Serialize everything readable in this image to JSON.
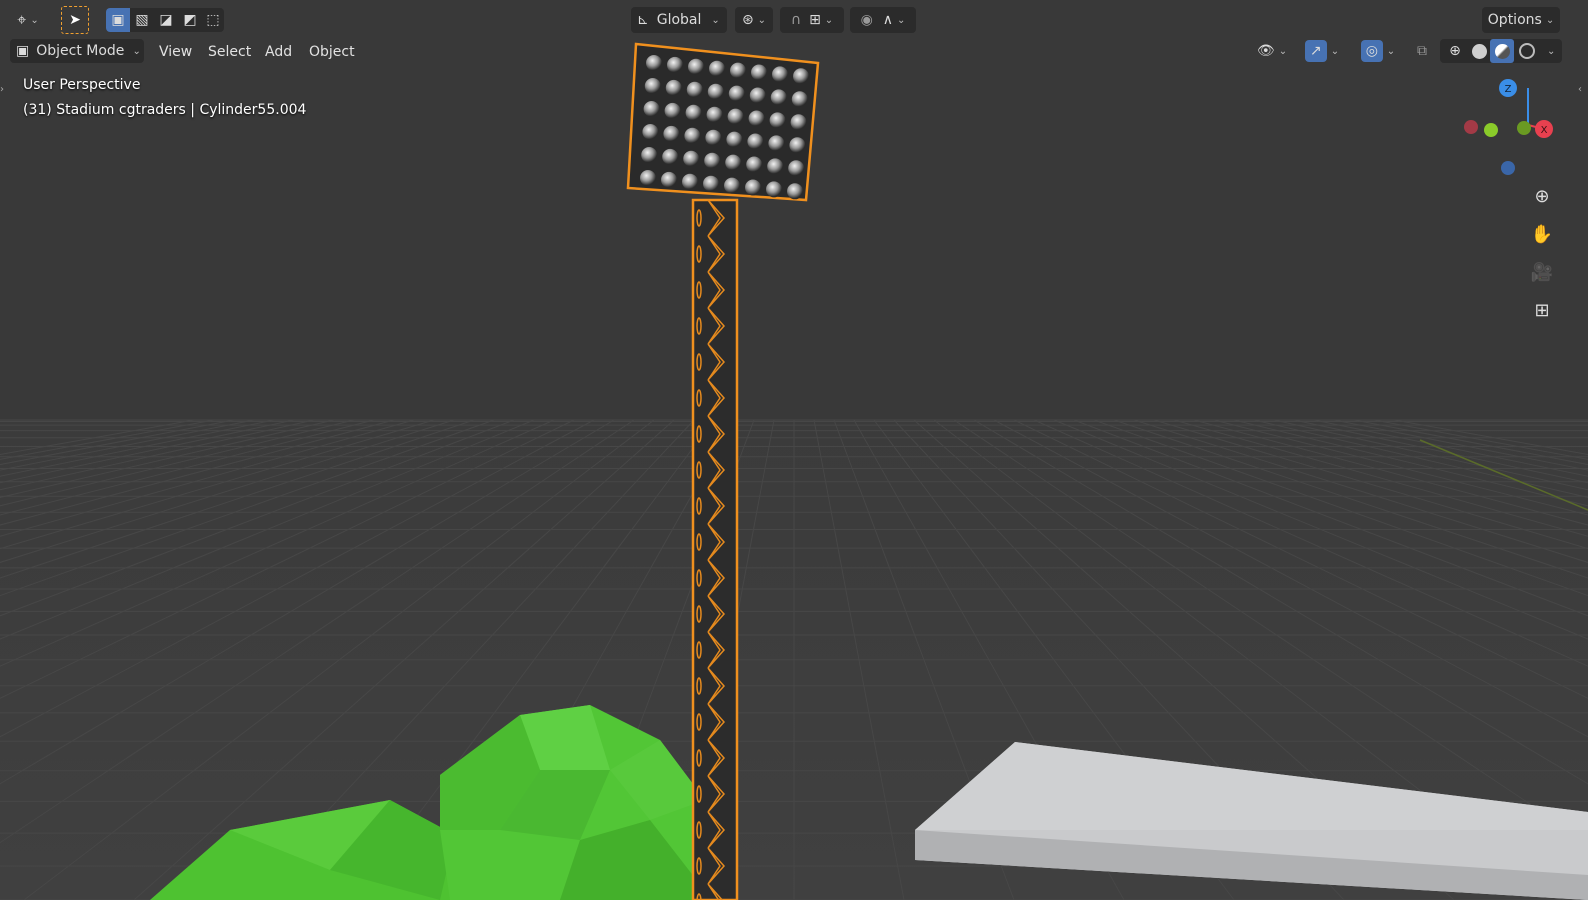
{
  "topbar": {
    "transform_orientation": "Global",
    "options_label": "Options"
  },
  "menubar": {
    "mode_label": "Object Mode",
    "menus": [
      "View",
      "Select",
      "Add",
      "Object"
    ]
  },
  "viewport": {
    "perspective_label": "User Perspective",
    "object_info": "(31) Stadium cgtraders | Cylinder55.004"
  },
  "gizmo": {
    "axis_z": "Z",
    "axis_x": "X",
    "axis_y": "Y"
  },
  "colors": {
    "accent_blue": "#4772b3",
    "selection_orange": "#f0901e",
    "axis_x": "#e8404f",
    "axis_y": "#8acb2a",
    "axis_z": "#3a8ee8",
    "background": "#3a3a3a",
    "foliage": "#4fc337"
  },
  "icons": {
    "editor_type": "cursor-editor-icon",
    "select_tool": "select-arrow-icon",
    "transform_pivot": "pivot-icon",
    "snap": "magnet-icon",
    "proportional": "proportional-edit-icon",
    "visibility": "eye-icon",
    "gizmo_toggle": "gizmo-icon",
    "overlays": "overlay-icon",
    "xray": "xray-icon",
    "shading_wire": "wireframe-shading-icon",
    "shading_solid": "solid-shading-icon",
    "shading_material": "material-shading-icon",
    "shading_rendered": "rendered-shading-icon",
    "zoom": "zoom-icon",
    "pan": "hand-icon",
    "camera": "camera-icon",
    "ortho": "grid-icon"
  }
}
